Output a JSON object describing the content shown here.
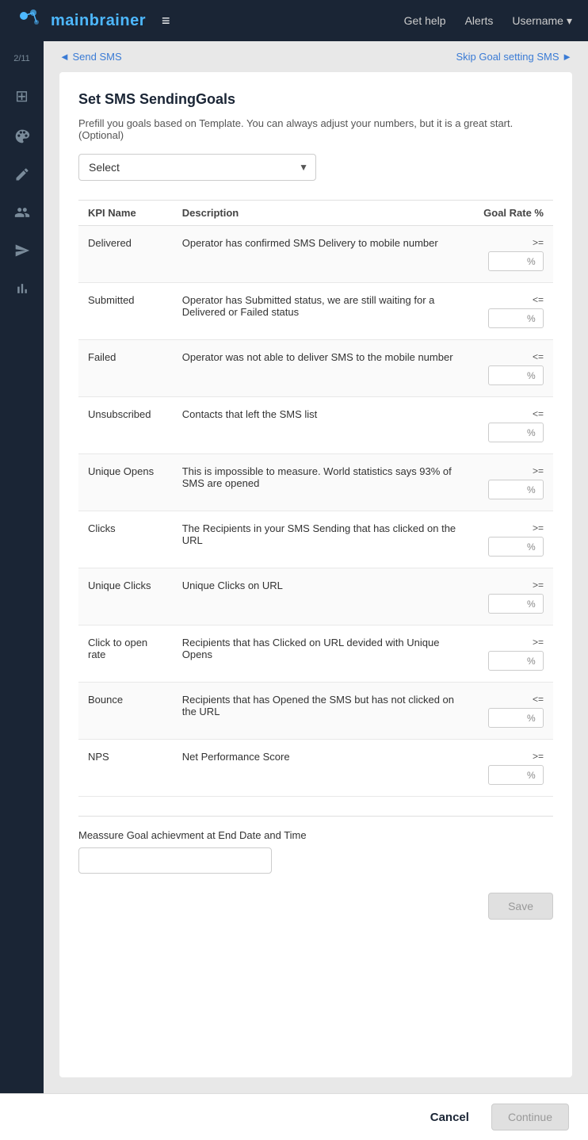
{
  "topnav": {
    "logo_main": "main",
    "logo_brand": "brainer",
    "hamburger": "≡",
    "get_help": "Get help",
    "alerts": "Alerts",
    "username": "Username"
  },
  "sidebar": {
    "step_label": "2/11",
    "icons": [
      {
        "name": "table-icon",
        "glyph": "⊞"
      },
      {
        "name": "palette-icon",
        "glyph": "🎨"
      },
      {
        "name": "edit-icon",
        "glyph": "✏"
      },
      {
        "name": "users-icon",
        "glyph": "👥"
      },
      {
        "name": "send-icon",
        "glyph": "➤"
      },
      {
        "name": "chart-icon",
        "glyph": "📊"
      }
    ]
  },
  "breadcrumb": {
    "back": "Send SMS",
    "forward": "Skip Goal setting SMS"
  },
  "card": {
    "title": "Set SMS SendingGoals",
    "subtitle": "Prefill you goals based on Template. You can always adjust your numbers, but it is a great start.(Optional)",
    "select_placeholder": "Select",
    "select_options": [
      "Select"
    ],
    "table": {
      "headers": [
        "KPI Name",
        "Description",
        "Goal Rate %"
      ],
      "rows": [
        {
          "kpi": "Delivered",
          "description": "Operator has confirmed SMS Delivery to mobile number",
          "operator": ">=",
          "value": ""
        },
        {
          "kpi": "Submitted",
          "description": "Operator has Submitted status, we are still waiting for a Delivered or Failed status",
          "operator": "<=",
          "value": ""
        },
        {
          "kpi": "Failed",
          "description": "Operator was not able to deliver SMS to the mobile number",
          "operator": "<=",
          "value": ""
        },
        {
          "kpi": "Unsubscribed",
          "description": "Contacts that left the SMS list",
          "operator": "<=",
          "value": ""
        },
        {
          "kpi": "Unique Opens",
          "description": "This is impossible to measure. World statistics says 93% of SMS are opened",
          "operator": ">=",
          "value": ""
        },
        {
          "kpi": "Clicks",
          "description": "The Recipients in your SMS Sending that has clicked on the URL",
          "operator": ">=",
          "value": ""
        },
        {
          "kpi": "Unique Clicks",
          "description": "Unique Clicks on URL",
          "operator": ">=",
          "value": ""
        },
        {
          "kpi": "Click to open rate",
          "description": "Recipients that has Clicked on URL devided with Unique Opens",
          "operator": ">=",
          "value": ""
        },
        {
          "kpi": "Bounce",
          "description": "Recipients that has Opened the SMS but has not clicked on the URL",
          "operator": "<=",
          "value": ""
        },
        {
          "kpi": "NPS",
          "description": "Net Performance Score",
          "operator": ">=",
          "value": ""
        }
      ]
    },
    "measure_label": "Meassure Goal achievment at End Date and Time",
    "measure_placeholder": "",
    "save_button": "Save"
  },
  "bottom_bar": {
    "cancel_label": "Cancel",
    "continue_label": "Continue"
  }
}
